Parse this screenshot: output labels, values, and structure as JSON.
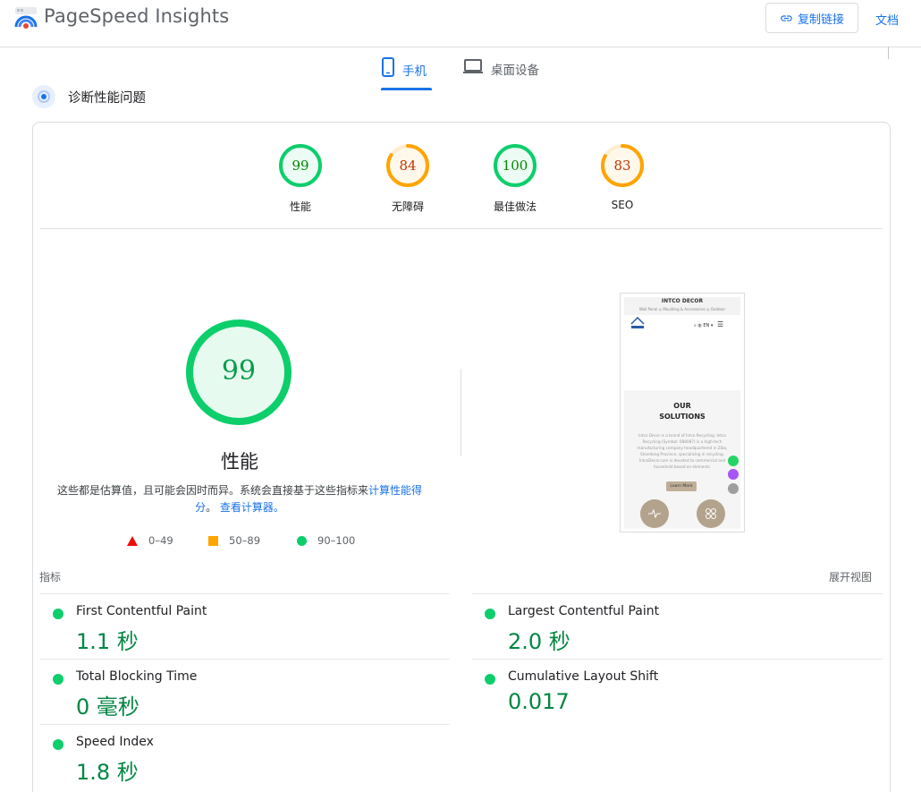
{
  "header": {
    "app_title": "PageSpeed Insights",
    "copy_link_label": "复制链接",
    "docs_label": "文档"
  },
  "tabs": [
    {
      "label": "手机",
      "active": true
    },
    {
      "label": "桌面设备",
      "active": false
    }
  ],
  "section_title": "诊断性能问题",
  "scores": [
    {
      "name": "性能",
      "value": 99,
      "color": "#0cce6b"
    },
    {
      "name": "无障碍",
      "value": 84,
      "color": "#ffa400"
    },
    {
      "name": "最佳做法",
      "value": 100,
      "color": "#0cce6b"
    },
    {
      "name": "SEO",
      "value": 83,
      "color": "#ffa400"
    }
  ],
  "main_score": {
    "value": 99,
    "label": "性能",
    "color": "#0cce6b"
  },
  "description": {
    "text": "这些都是估算值，且可能会因时而异。系统会直接基于这些指标来",
    "link1": "计算性能得分",
    "mid": "。",
    "link2": "查看计算器。"
  },
  "legend": {
    "fail": "0–49",
    "average": "50–89",
    "pass": "90–100"
  },
  "screenshot": {
    "brand": "INTCO DECOR",
    "nav_items": "Wall Panel ◎   Moulding & Accessories ◎   Outdoor",
    "lang": "EN ▾",
    "hero_line1": "OUR",
    "hero_line2": "SOLUTIONS",
    "hero_text": "Intco Decor is a brand of Intco Recycling. Intco Recycling (Symbol: 688087) is a high-tech manufacturing company headquartered in Zibo, Shandong Province, specializing in recycling. IntcoDecor.com is devoted to commercial and household based on elements.",
    "learn_more": "Learn More"
  },
  "metrics_section": {
    "label": "指标",
    "expand": "展开视图"
  },
  "metrics": [
    {
      "name": "First Contentful Paint",
      "value": "1.1 秒"
    },
    {
      "name": "Largest Contentful Paint",
      "value": "2.0 秒"
    },
    {
      "name": "Total Blocking Time",
      "value": "0 毫秒"
    },
    {
      "name": "Cumulative Layout Shift",
      "value": "0.017"
    },
    {
      "name": "Speed Index",
      "value": "1.8 秒"
    }
  ],
  "colors": {
    "accent": "#1a73e8",
    "pass": "#0cce6b",
    "average": "#ffa400",
    "fail": "#eb0f00",
    "metric_value": "#018642"
  }
}
